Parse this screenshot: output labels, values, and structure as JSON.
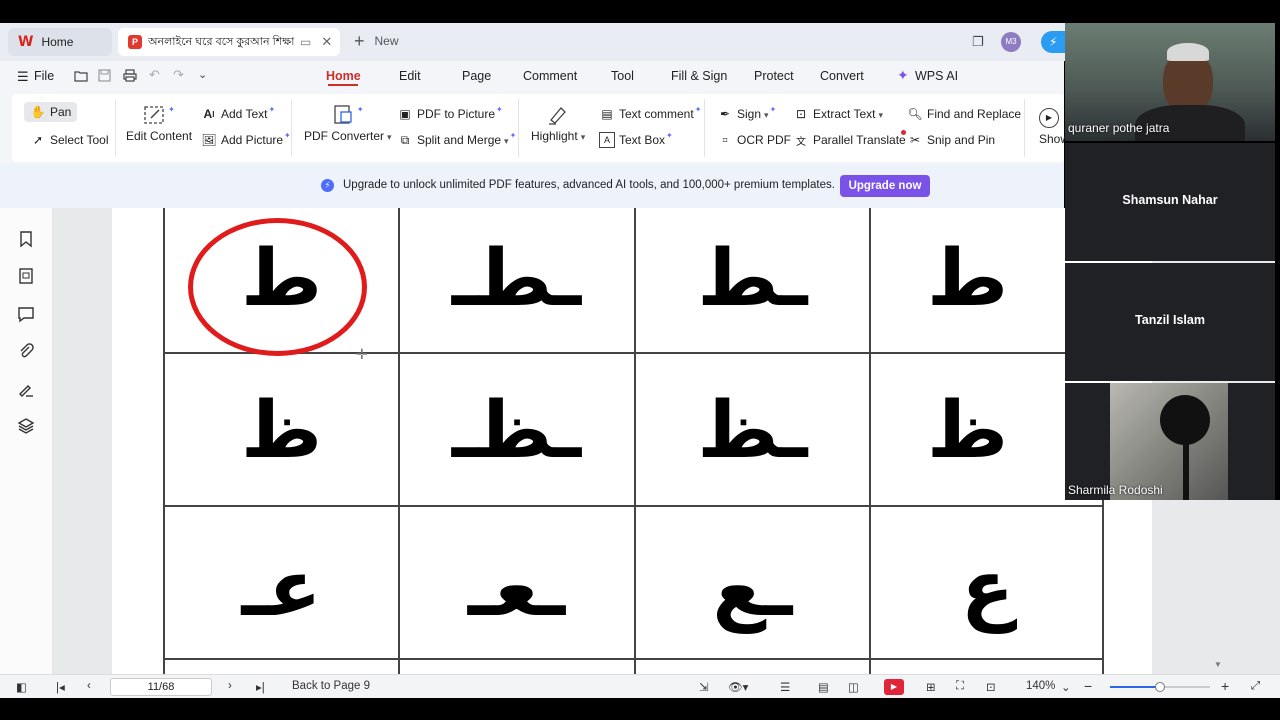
{
  "tabs": {
    "home_label": "Home",
    "doc_label": "অনলাইনে ঘরে বসে কুরআন শিক্ষা",
    "new_label": "New",
    "avatar_text": "M3"
  },
  "menu": {
    "file": "File",
    "items": [
      "Home",
      "Edit",
      "Page",
      "Comment",
      "Tool",
      "Fill & Sign",
      "Protect",
      "Convert",
      "WPS AI"
    ]
  },
  "ribbon": {
    "pan": "Pan",
    "select_tool": "Select Tool",
    "edit_content": "Edit Content",
    "add_text": "Add Text",
    "add_picture": "Add Picture",
    "pdf_converter": "PDF Converter",
    "pdf_to_picture": "PDF to Picture",
    "split_merge": "Split and Merge",
    "highlight": "Highlight",
    "text_comment": "Text comment",
    "text_box": "Text Box",
    "sign": "Sign",
    "ocr_pdf": "OCR PDF",
    "extract_text": "Extract Text",
    "parallel_translate": "Parallel Translate",
    "find_replace": "Find and Replace",
    "snip_pin": "Snip and Pin",
    "show": "Show"
  },
  "banner": {
    "text": "Upgrade to unlock unlimited PDF features, advanced AI tools, and 100,000+ premium templates.",
    "button": "Upgrade now"
  },
  "document": {
    "row1": [
      "ط",
      "ـطـ",
      "ـط",
      "ط"
    ],
    "row2": [
      "ظ",
      "ـظـ",
      "ـظ",
      "ظ"
    ],
    "row3": [
      "عـ",
      "ـعـ",
      "ـع",
      "ع"
    ]
  },
  "status": {
    "page": "11/68",
    "back": "Back to Page 9",
    "zoom": "140%",
    "zoom_level": 0.5
  },
  "participants": [
    {
      "name": "quraner pothe jatra"
    },
    {
      "name": "Shamsun Nahar"
    },
    {
      "name": "Tanzil Islam"
    },
    {
      "name": "Sharmila Rodoshi"
    }
  ],
  "colors": {
    "accent": "#c9302c",
    "upgrade": "#7b52e8",
    "circle": "#e01b1b"
  }
}
